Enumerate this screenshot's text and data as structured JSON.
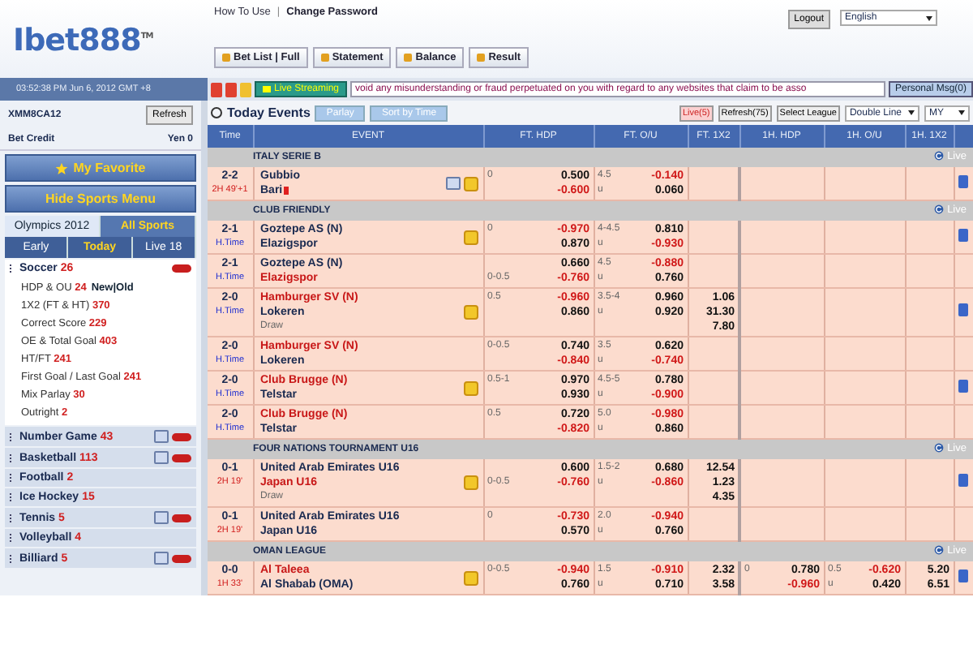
{
  "logo": {
    "name": "Ibet888",
    "mark": "TM"
  },
  "top_links": [
    "How To Use",
    "Change Password"
  ],
  "link_separator": "|",
  "logout": "Logout",
  "language": "English",
  "top_buttons": [
    "Bet List | Full",
    "Statement",
    "Balance",
    "Result"
  ],
  "datetime": "03:52:38 PM Jun 6, 2012 GMT +8",
  "live_streaming": "Live Streaming",
  "ticker": "void any misunderstanding or fraud perpetuated on you with regard to any websites that claim to be asso",
  "personal_msg": "Personal Msg(0)",
  "account": {
    "id": "XMM8CA12",
    "refresh": "Refresh",
    "credit_label": "Bet Credit",
    "credit": "Yen 0"
  },
  "my_favorite": "My Favorite",
  "hide_menu": "Hide Sports Menu",
  "tabs": [
    {
      "label": "Olympics 2012",
      "selected": false
    },
    {
      "label": "All Sports",
      "selected": true
    }
  ],
  "periods": [
    {
      "label": "Early",
      "selected": false
    },
    {
      "label": "Today",
      "selected": true
    },
    {
      "label": "Live 18",
      "selected": false
    }
  ],
  "sports": [
    {
      "name": "Soccer",
      "count": "26",
      "expanded": true,
      "live": true,
      "tv": false,
      "children": [
        {
          "label": "HDP & OU",
          "count": "24",
          "extra": "New|Old"
        },
        {
          "label": "1X2 (FT & HT)",
          "count": "370"
        },
        {
          "label": "Correct Score",
          "count": "229"
        },
        {
          "label": "OE & Total Goal",
          "count": "403"
        },
        {
          "label": "HT/FT",
          "count": "241"
        },
        {
          "label": "First Goal / Last Goal",
          "count": "241"
        },
        {
          "label": "Mix Parlay",
          "count": "30"
        },
        {
          "label": "Outright",
          "count": "2"
        }
      ]
    },
    {
      "name": "Number Game",
      "count": "43",
      "expanded": false,
      "live": true,
      "tv": true
    },
    {
      "name": "Basketball",
      "count": "113",
      "expanded": false,
      "live": true,
      "tv": true
    },
    {
      "name": "Football",
      "count": "2",
      "expanded": false,
      "live": false,
      "tv": false
    },
    {
      "name": "Ice Hockey",
      "count": "15",
      "expanded": false,
      "live": false,
      "tv": false
    },
    {
      "name": "Tennis",
      "count": "5",
      "expanded": false,
      "live": true,
      "tv": true
    },
    {
      "name": "Volleyball",
      "count": "4",
      "expanded": false,
      "live": false,
      "tv": false
    },
    {
      "name": "Billiard",
      "count": "5",
      "expanded": false,
      "live": true,
      "tv": true
    }
  ],
  "events_title": "Today Events",
  "event_buttons": [
    "Parlay",
    "Sort by Time"
  ],
  "filters": [
    {
      "label": "Live(5)",
      "kind": "live"
    },
    {
      "label": "Refresh(75)",
      "kind": "plain"
    },
    {
      "label": "Select League",
      "kind": "plain"
    }
  ],
  "line_select": "Double Line",
  "odds_select": "MY",
  "columns": [
    "Time",
    "EVENT",
    "FT. HDP",
    "FT. O/U",
    "FT. 1X2",
    "1H. HDP",
    "1H. O/U",
    "1H. 1X2"
  ],
  "leagues": [
    {
      "name": "ITALY SERIE B",
      "live_label": "Live",
      "matches": [
        {
          "score": "2-2",
          "period": "2H 49'+1",
          "in_play": true,
          "home": "Gubbio",
          "away": "Bari",
          "home_favored": false,
          "away_favored": false,
          "red_card": true,
          "tv": true,
          "star": true,
          "info": true,
          "ft": {
            "hdp_home": "0",
            "hdp_odds": [
              "0.500",
              "-0.600"
            ],
            "ou": "4.5",
            "under": "u",
            "ou_odds": [
              "-0.140",
              "0.060"
            ]
          }
        }
      ]
    },
    {
      "name": "CLUB FRIENDLY",
      "live_label": "Live",
      "matches": [
        {
          "score": "2-1",
          "period": "H.Time",
          "in_play": false,
          "home": "Goztepe AS (N)",
          "away": "Elazigspor",
          "home_favored": false,
          "away_favored": false,
          "red_card": false,
          "tv": false,
          "star": true,
          "info": true,
          "ft": {
            "hdp_home": "0",
            "hdp_odds": [
              "-0.970",
              "0.870"
            ],
            "ou": "4-4.5",
            "under": "u",
            "ou_odds": [
              "0.810",
              "-0.930"
            ]
          }
        },
        {
          "score": "2-1",
          "period": "H.Time",
          "in_play": false,
          "home": "Goztepe AS (N)",
          "away": "Elazigspor",
          "home_favored": false,
          "away_favored": true,
          "red_card": false,
          "tv": false,
          "star": false,
          "info": false,
          "ft": {
            "hdp_away": "0-0.5",
            "hdp_odds": [
              "0.660",
              "-0.760"
            ],
            "ou": "4.5",
            "under": "u",
            "ou_odds": [
              "-0.880",
              "0.760"
            ]
          }
        },
        {
          "score": "2-0",
          "period": "H.Time",
          "in_play": false,
          "home": "Hamburger SV (N)",
          "away": "Lokeren",
          "draw": "Draw",
          "home_favored": true,
          "away_favored": false,
          "red_card": false,
          "tv": false,
          "star": true,
          "info": true,
          "ft": {
            "hdp_home": "0.5",
            "hdp_odds": [
              "-0.960",
              "0.860"
            ],
            "ou": "3.5-4",
            "under": "u",
            "ou_odds": [
              "0.960",
              "0.920"
            ],
            "x12": [
              "1.06",
              "31.30",
              "7.80"
            ]
          }
        },
        {
          "score": "2-0",
          "period": "H.Time",
          "in_play": false,
          "home": "Hamburger SV (N)",
          "away": "Lokeren",
          "home_favored": true,
          "away_favored": false,
          "red_card": false,
          "tv": false,
          "star": false,
          "info": false,
          "ft": {
            "hdp_home": "0-0.5",
            "hdp_odds": [
              "0.740",
              "-0.840"
            ],
            "ou": "3.5",
            "under": "u",
            "ou_odds": [
              "0.620",
              "-0.740"
            ]
          }
        },
        {
          "score": "2-0",
          "period": "H.Time",
          "in_play": false,
          "home": "Club Brugge (N)",
          "away": "Telstar",
          "home_favored": true,
          "away_favored": false,
          "red_card": false,
          "tv": false,
          "star": true,
          "info": true,
          "ft": {
            "hdp_home": "0.5-1",
            "hdp_odds": [
              "0.970",
              "0.930"
            ],
            "ou": "4.5-5",
            "under": "u",
            "ou_odds": [
              "0.780",
              "-0.900"
            ]
          }
        },
        {
          "score": "2-0",
          "period": "H.Time",
          "in_play": false,
          "home": "Club Brugge (N)",
          "away": "Telstar",
          "home_favored": true,
          "away_favored": false,
          "red_card": false,
          "tv": false,
          "star": false,
          "info": false,
          "ft": {
            "hdp_home": "0.5",
            "hdp_odds": [
              "0.720",
              "-0.820"
            ],
            "ou": "5.0",
            "under": "u",
            "ou_odds": [
              "-0.980",
              "0.860"
            ]
          }
        }
      ]
    },
    {
      "name": "FOUR NATIONS TOURNAMENT U16",
      "live_label": "Live",
      "matches": [
        {
          "score": "0-1",
          "period": "2H 19'",
          "in_play": true,
          "home": "United Arab Emirates U16",
          "away": "Japan U16",
          "draw": "Draw",
          "home_favored": false,
          "away_favored": true,
          "red_card": false,
          "tv": false,
          "star": true,
          "info": true,
          "ft": {
            "hdp_away": "0-0.5",
            "hdp_odds": [
              "0.600",
              "-0.760"
            ],
            "ou": "1.5-2",
            "under": "u",
            "ou_odds": [
              "0.680",
              "-0.860"
            ],
            "x12": [
              "12.54",
              "1.23",
              "4.35"
            ]
          }
        },
        {
          "score": "0-1",
          "period": "2H 19'",
          "in_play": true,
          "home": "United Arab Emirates U16",
          "away": "Japan U16",
          "home_favored": false,
          "away_favored": false,
          "red_card": false,
          "tv": false,
          "star": false,
          "info": false,
          "ft": {
            "hdp_home": "0",
            "hdp_odds": [
              "-0.730",
              "0.570"
            ],
            "ou": "2.0",
            "under": "u",
            "ou_odds": [
              "-0.940",
              "0.760"
            ]
          }
        }
      ]
    },
    {
      "name": "OMAN LEAGUE",
      "live_label": "Live",
      "matches": [
        {
          "score": "0-0",
          "period": "1H 33'",
          "in_play": true,
          "home": "Al Taleea",
          "away": "Al Shabab (OMA)",
          "home_favored": true,
          "away_favored": false,
          "red_card": false,
          "tv": false,
          "star": true,
          "info": true,
          "ft": {
            "hdp_home": "0-0.5",
            "hdp_odds": [
              "-0.940",
              "0.760"
            ],
            "ou": "1.5",
            "under": "u",
            "ou_odds": [
              "-0.910",
              "0.710"
            ],
            "x12": [
              "2.32",
              "3.58"
            ]
          },
          "h1": {
            "hdp_home": "0",
            "hdp_odds": [
              "0.780",
              "-0.960"
            ],
            "ou": "0.5",
            "under": "u",
            "ou_odds": [
              "-0.620",
              "0.420"
            ],
            "x12": [
              "5.20",
              "6.51"
            ]
          }
        }
      ]
    }
  ]
}
